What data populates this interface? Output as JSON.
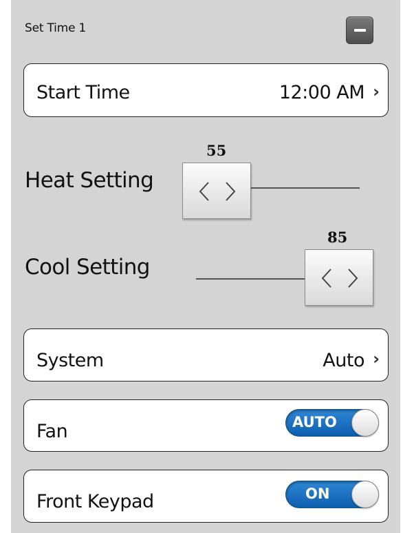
{
  "section": {
    "title": "Set Time 1"
  },
  "start_time": {
    "label": "Start Time",
    "value": "12:00 AM",
    "chevron": "›"
  },
  "heat_setting": {
    "label": "Heat Setting",
    "value": "55",
    "slider_level": 0.0
  },
  "cool_setting": {
    "label": "Cool Setting",
    "value": "85",
    "slider_level": 1.0
  },
  "system": {
    "label": "System",
    "value": "Auto",
    "chevron": "›"
  },
  "fan": {
    "label": "Fan",
    "toggle_text": "AUTO"
  },
  "front_keypad": {
    "label": "Front Keypad",
    "toggle_text": "ON"
  },
  "colors": {
    "panel_background": "#d4d4d4",
    "toggle_blue": "#1a6fc0",
    "collapse_button": "#5f5f5f"
  }
}
